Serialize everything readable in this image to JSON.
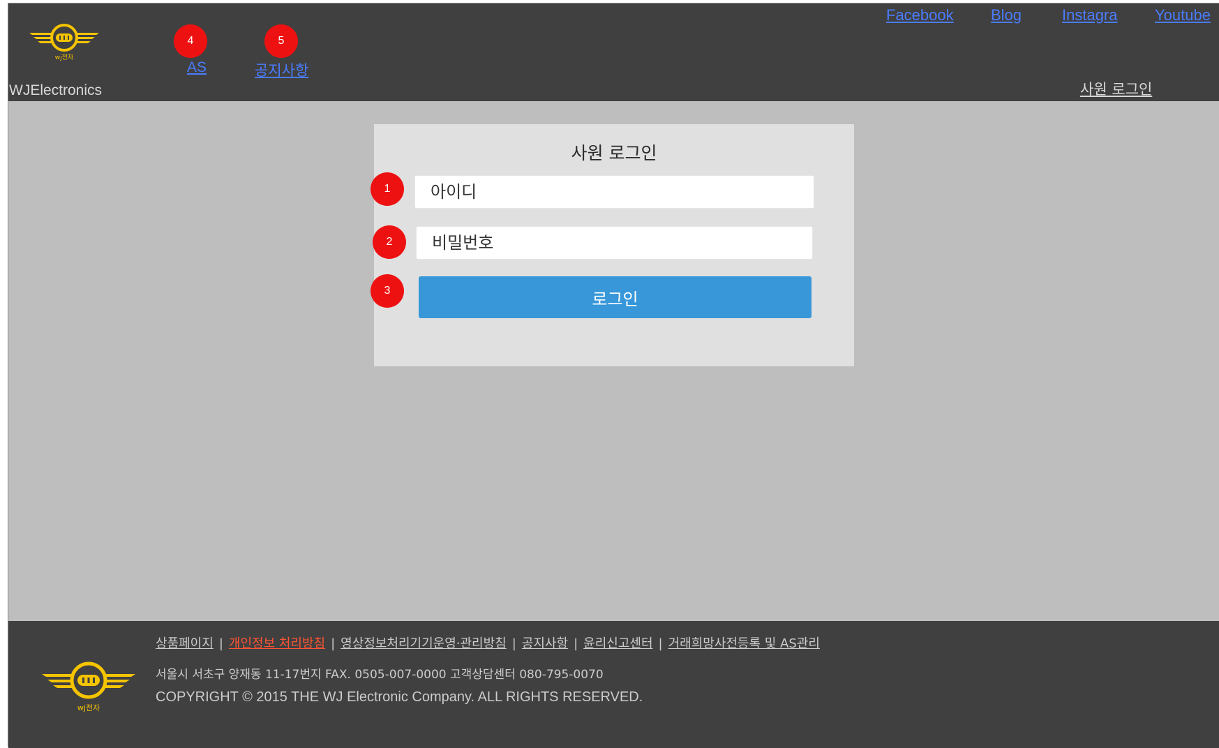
{
  "header": {
    "brand": "WJElectronics",
    "logo_text": "wj전자",
    "nav": [
      {
        "badge": "4",
        "label": "AS"
      },
      {
        "badge": "5",
        "label": "공지사항"
      }
    ],
    "social": [
      "Facebook",
      "Blog",
      "Instagra",
      "Youtube"
    ],
    "staff_login_link": "사원 로그인"
  },
  "login": {
    "title": "사원 로그인",
    "id_placeholder": "아이디",
    "password_placeholder": "비밀번호",
    "submit_label": "로그인",
    "badges": [
      "1",
      "2",
      "3"
    ]
  },
  "footer": {
    "logo_text": "wj전자",
    "links": [
      "상품페이지",
      "개인정보 처리방침",
      "영상정보처리기기운영·관리방침",
      "공지사항",
      "윤리신고센터",
      "거래희망사전등록 및 AS관리"
    ],
    "address": "서울시 서초구 양재동 11-17번지   FAX. 0505-007-0000   고객상담센터 080-795-0070",
    "copyright": "COPYRIGHT © 2015 THE WJ Electronic Company.  ALL RIGHTS RESERVED."
  },
  "colors": {
    "header_bg": "#404040",
    "page_bg": "#bebebe",
    "card_bg": "#e0e0e0",
    "button_bg": "#3797d9",
    "badge_bg": "#ee1111",
    "link_blue": "#4a7cff",
    "logo_yellow": "#f5c400",
    "footer_accent": "#ff5533"
  }
}
